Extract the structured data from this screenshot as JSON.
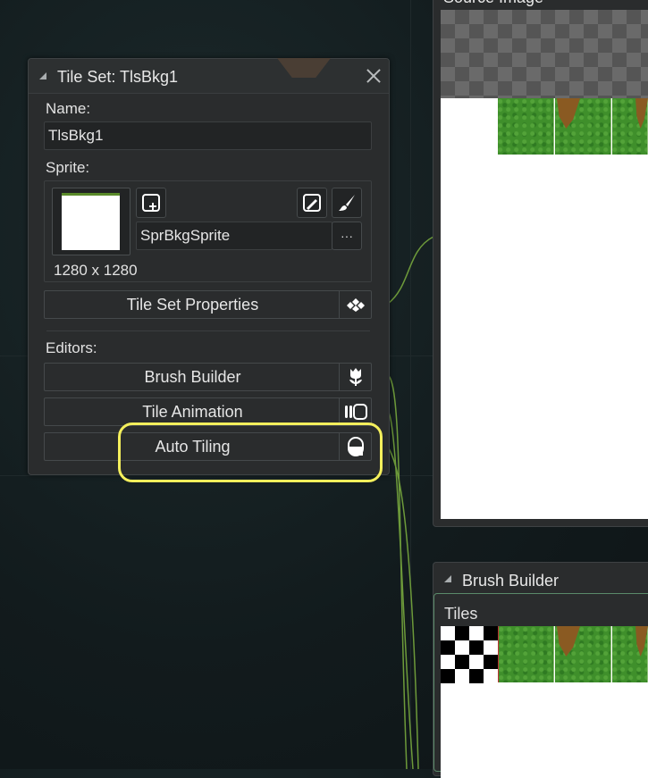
{
  "tileset_window": {
    "title": "Tile Set: TlsBkg1",
    "name_label": "Name:",
    "name_value": "TlsBkg1",
    "sprite_label": "Sprite:",
    "sprite_name": "SprBkgSprite",
    "sprite_more": "···",
    "sprite_size": "1280 x 1280",
    "properties_button": "Tile Set Properties",
    "editors_label": "Editors:",
    "editors": [
      {
        "label": "Brush Builder",
        "icon": "tulip-icon"
      },
      {
        "label": "Tile Animation",
        "icon": "film-frames-icon"
      },
      {
        "label": "Auto Tiling",
        "icon": "auto-tile-icon"
      }
    ]
  },
  "source_panel": {
    "title": "Source Image"
  },
  "brush_builder_panel": {
    "title": "Brush Builder",
    "tiles_label": "Tiles"
  },
  "colors": {
    "highlight": "#f4ef5c",
    "wire": "#6d9a3a",
    "grass": "#3f8f2b"
  }
}
